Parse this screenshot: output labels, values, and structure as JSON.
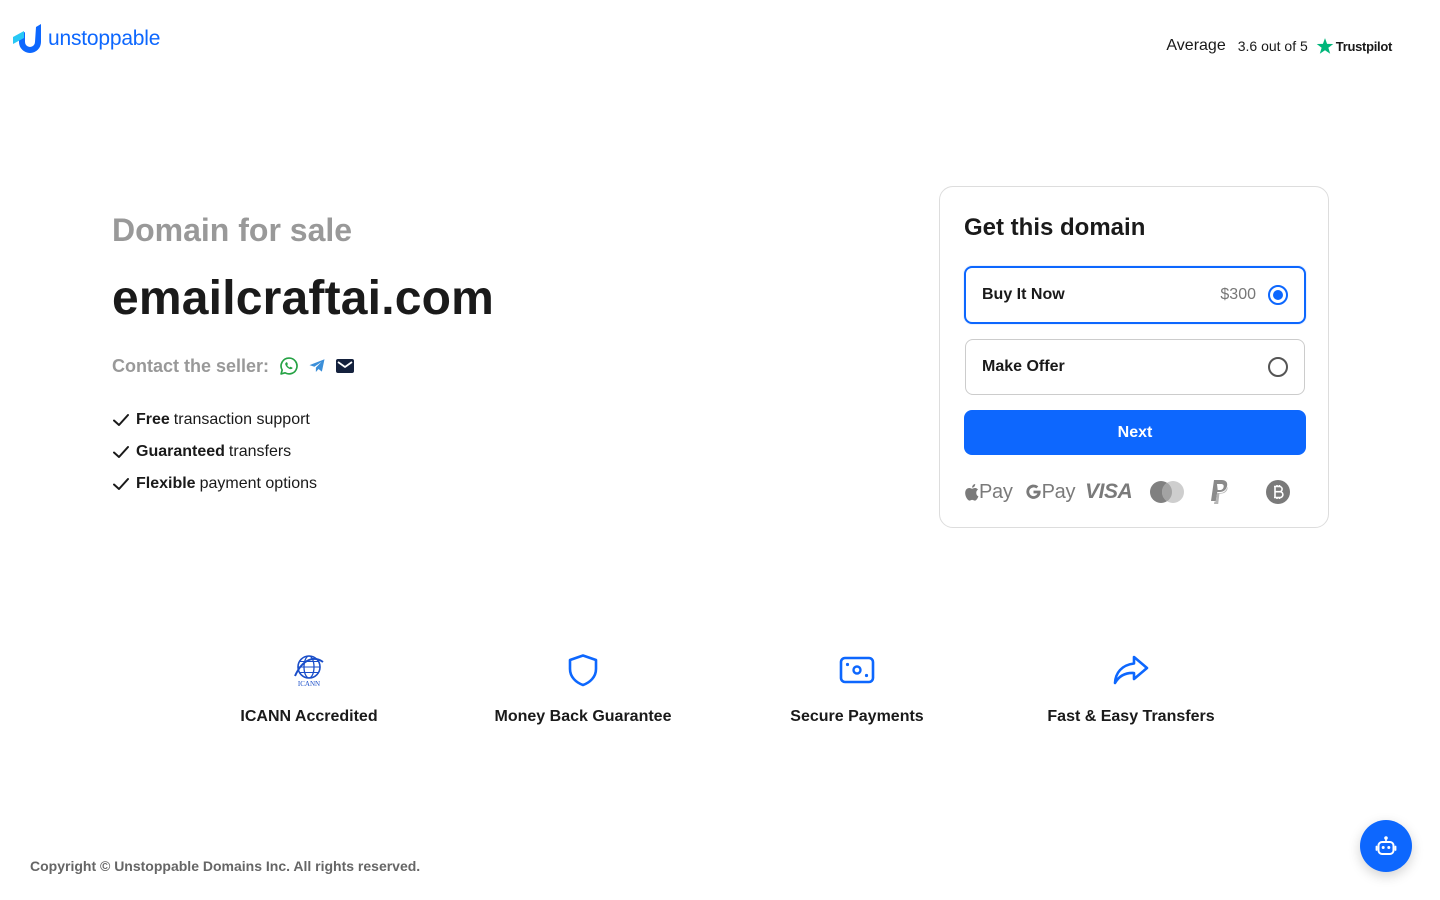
{
  "header": {
    "brand": "unstoppable",
    "rating": {
      "label": "Average",
      "score": "3.6 out of 5",
      "provider": "Trustpilot"
    }
  },
  "hero": {
    "subtitle": "Domain for sale",
    "domain": "emailcraftai.com",
    "contact_label": "Contact the seller:",
    "contact_icons": [
      "whatsapp-icon",
      "telegram-icon",
      "email-icon"
    ],
    "features": [
      {
        "bold": "Free",
        "rest": "transaction support"
      },
      {
        "bold": "Guaranteed",
        "rest": "transfers"
      },
      {
        "bold": "Flexible",
        "rest": "payment options"
      }
    ]
  },
  "purchase": {
    "title": "Get this domain",
    "options": [
      {
        "label": "Buy It Now",
        "price": "$300",
        "selected": true
      },
      {
        "label": "Make Offer",
        "selected": false
      }
    ],
    "next_label": "Next",
    "payment_methods": {
      "apple_pay": "Pay",
      "google_pay": "Pay",
      "visa": "VISA",
      "icons": [
        "apple-pay-icon",
        "google-pay-icon",
        "visa-icon",
        "mastercard-icon",
        "paypal-icon",
        "bitcoin-icon"
      ]
    }
  },
  "trust": [
    {
      "label": "ICANN Accredited",
      "icon": "icann-icon",
      "logo_text": "ICANN"
    },
    {
      "label": "Money Back Guarantee",
      "icon": "shield-icon"
    },
    {
      "label": "Secure Payments",
      "icon": "cash-icon"
    },
    {
      "label": "Fast & Easy Transfers",
      "icon": "share-arrow-icon"
    }
  ],
  "footer": {
    "copyright": "Copyright © Unstoppable Domains Inc. All rights reserved."
  },
  "colors": {
    "accent": "#0d67fe",
    "muted_text": "#999999",
    "whatsapp": "#25a244",
    "telegram": "#3b8fd9",
    "trustpilot": "#00b67a"
  }
}
